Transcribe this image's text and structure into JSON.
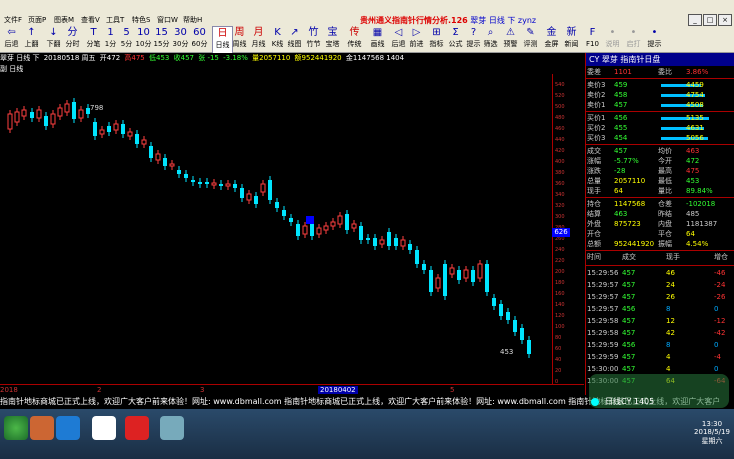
{
  "menubar": {
    "items": [
      "文件F",
      "页面P",
      "图表M",
      "查看V",
      "工具T",
      "特色S",
      "窗口W",
      "帮助H"
    ],
    "title_prefix": "贵州通义指南针行情分析.126",
    "title_stock": "翠芽 日线 下 zynz",
    "win_buttons": [
      "_",
      "□",
      "×"
    ]
  },
  "toolbar": [
    {
      "top": "⇦",
      "label": "后退"
    },
    {
      "top": "↑",
      "label": "上翻"
    },
    {
      "top": "↓",
      "label": "下翻"
    },
    {
      "top": "分",
      "label": "分时"
    },
    {
      "top": "T",
      "label": "分笔"
    },
    {
      "top": "1",
      "label": "1分"
    },
    {
      "top": "5",
      "label": "5分"
    },
    {
      "top": "10",
      "label": "10分"
    },
    {
      "top": "15",
      "label": "15分"
    },
    {
      "top": "30",
      "label": "30分"
    },
    {
      "top": "60",
      "label": "60分"
    },
    {
      "top": "日",
      "label": "日线",
      "selected": true
    },
    {
      "top": "周",
      "label": "周线"
    },
    {
      "top": "月",
      "label": "月线"
    },
    {
      "top": "K",
      "label": "K线"
    },
    {
      "top": "↗",
      "label": "线图"
    },
    {
      "top": "竹",
      "label": "竹节"
    },
    {
      "top": "宝",
      "label": "宝塔"
    },
    {
      "top": "传",
      "label": "传统"
    },
    {
      "top": "▦",
      "label": "画线"
    },
    {
      "top": "◁",
      "label": "后退"
    },
    {
      "top": "▷",
      "label": "前进"
    },
    {
      "top": "⊞",
      "label": "指标"
    },
    {
      "top": "Σ",
      "label": "公式"
    },
    {
      "top": "?",
      "label": "提示"
    },
    {
      "top": "⌕",
      "label": "筛选"
    },
    {
      "top": "⚠",
      "label": "预警"
    },
    {
      "top": "✎",
      "label": "评测"
    },
    {
      "top": "金",
      "label": "金屏"
    },
    {
      "top": "新",
      "label": "新闻"
    },
    {
      "top": "F",
      "label": "F10"
    },
    {
      "top": "•",
      "label": "说明",
      "gray": true
    },
    {
      "top": "•",
      "label": "启打",
      "gray": true
    },
    {
      "top": "•",
      "label": "提示"
    }
  ],
  "infobar": {
    "prefix": "翠芽 日线 下",
    "date": "20180518 周五",
    "open": "开472",
    "high": "高475",
    "low": "低453",
    "close": "收457",
    "change": "张 -15",
    "pct": "-3.18%",
    "vol": "量2057110",
    "amt": "额952441920",
    "extra": "金1147568 1404"
  },
  "subbar": "副 日线",
  "chart_data": {
    "type": "candlestick",
    "y_ticks": [
      540,
      520,
      500,
      480,
      460,
      440,
      420,
      400,
      380,
      360,
      340,
      320,
      300,
      280,
      260,
      240,
      220,
      200,
      180,
      160,
      140,
      120,
      100,
      80,
      60,
      40,
      20,
      0
    ],
    "x_ticks": [
      "2018",
      "2",
      "3",
      "20180402",
      "5"
    ],
    "annotations": [
      "798",
      "453"
    ],
    "price_tag": "626"
  },
  "quote": {
    "title": "CY 翠芽 指南针日盘",
    "committee": [
      {
        "l": "委差",
        "v": "1101"
      },
      {
        "l": "委比",
        "v": "3.86%"
      }
    ],
    "sells": [
      {
        "l": "卖价3",
        "v": "459",
        "q": "4459"
      },
      {
        "l": "卖价2",
        "v": "458",
        "q": "4754"
      },
      {
        "l": "卖价1",
        "v": "457",
        "q": "4508"
      }
    ],
    "buys": [
      {
        "l": "买价1",
        "v": "456",
        "q": "5135"
      },
      {
        "l": "买价2",
        "v": "455",
        "q": "4631"
      },
      {
        "l": "买价3",
        "v": "454",
        "q": "5056"
      }
    ],
    "stats": [
      {
        "l": "成交",
        "v": "457",
        "l2": "均价",
        "v2": "463"
      },
      {
        "l": "涨幅",
        "v": "-5.77%",
        "l2": "今开",
        "v2": "472"
      },
      {
        "l": "涨跌",
        "v": "-28",
        "l2": "最高",
        "v2": "475"
      },
      {
        "l": "总量",
        "v": "2057110",
        "l2": "最低",
        "v2": "453"
      },
      {
        "l": "现手",
        "v": "64",
        "l2": "量比",
        "v2": "89.84%"
      },
      {
        "l": "持仓",
        "v": "1147568",
        "l2": "仓差",
        "v2": "-102018"
      },
      {
        "l": "结算",
        "v": "463",
        "l2": "昨结",
        "v2": "485"
      },
      {
        "l": "外盘",
        "v": "875723",
        "l2": "内盘",
        "v2": "1181387"
      },
      {
        "l": "开仓",
        "v": "",
        "l2": "平仓",
        "v2": "64"
      },
      {
        "l": "总额",
        "v": "952441920",
        "l2": "振幅",
        "v2": "4.54%"
      }
    ],
    "ticks_header": [
      "时间",
      "成交",
      "现手",
      "增仓"
    ],
    "ticks": [
      {
        "t": "15:29:56",
        "p": "457",
        "h": "46",
        "z": "-46"
      },
      {
        "t": "15:29:57",
        "p": "457",
        "h": "24",
        "z": "-24"
      },
      {
        "t": "15:29:57",
        "p": "457",
        "h": "26",
        "z": "-26"
      },
      {
        "t": "15:29:57",
        "p": "456",
        "h": "8",
        "z": "0"
      },
      {
        "t": "15:29:58",
        "p": "457",
        "h": "12",
        "z": "-12"
      },
      {
        "t": "15:29:58",
        "p": "457",
        "h": "42",
        "z": "-42"
      },
      {
        "t": "15:29:59",
        "p": "456",
        "h": "8",
        "z": "0"
      },
      {
        "t": "15:29:59",
        "p": "457",
        "h": "4",
        "z": "-4"
      },
      {
        "t": "15:30:00",
        "p": "457",
        "h": "4",
        "z": "0"
      },
      {
        "t": "15:30:00",
        "p": "457",
        "h": "64",
        "z": "-64"
      }
    ]
  },
  "marquee": "指南针地标商城已正式上线，欢迎广大客户前来体验！网址: www.dbmall.com    指南针地标商城已正式上线，欢迎广大客户前来体验！网址: www.dbmall.com    指南针地标商城已正式上线，欢迎广大客户",
  "overlay": {
    "text": "日线CY 1405"
  },
  "taskbar": {
    "clock_time": "13:30",
    "clock_date": "2018/5/19 星期六"
  }
}
